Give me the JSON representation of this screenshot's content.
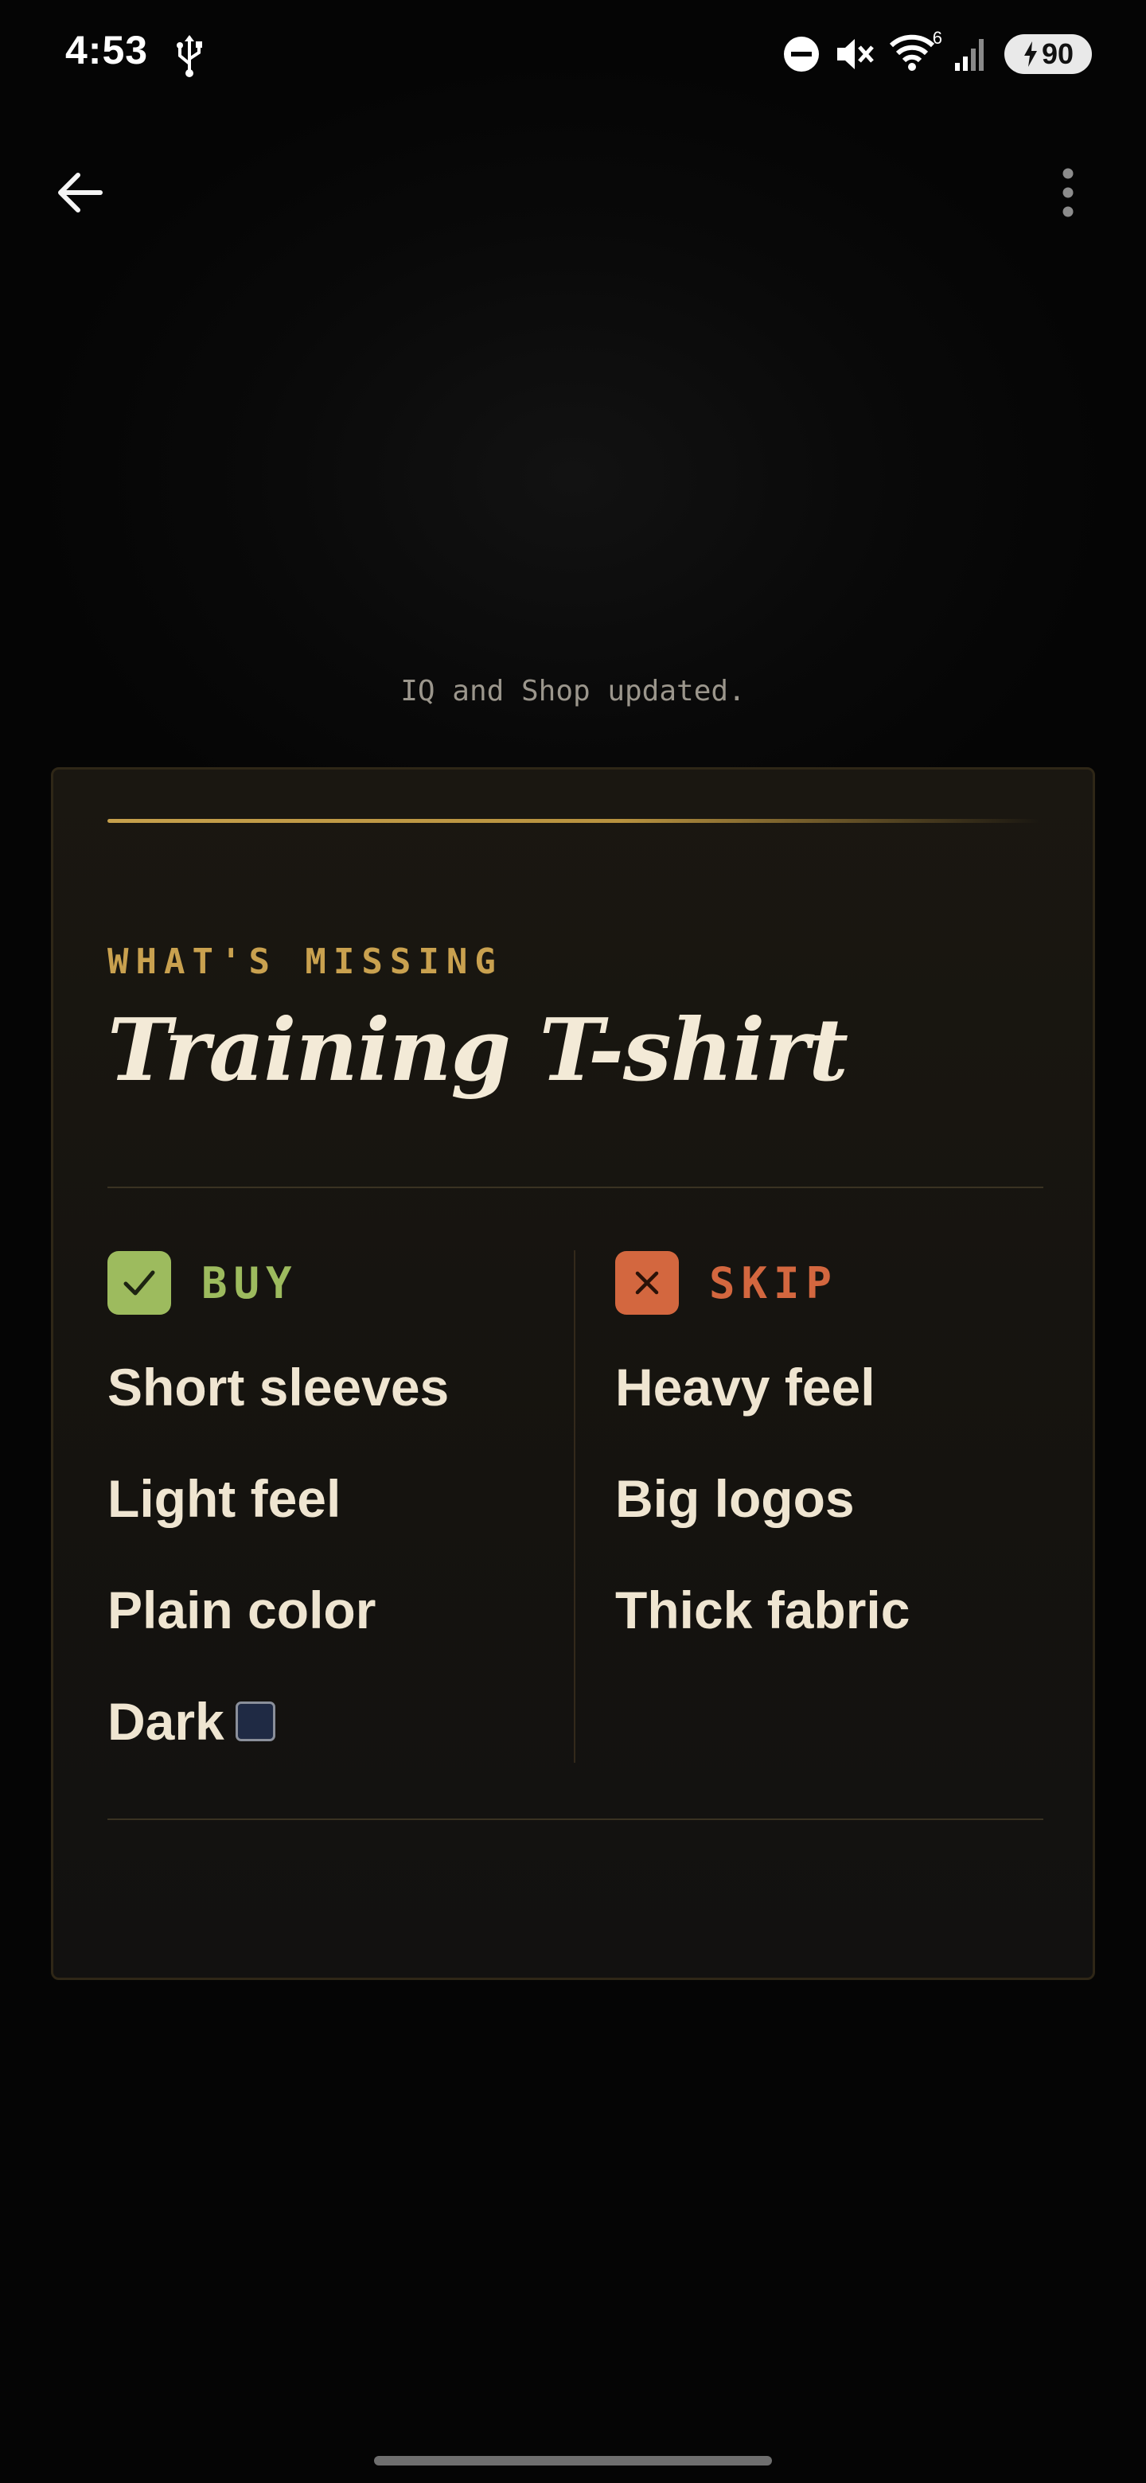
{
  "status_bar": {
    "time": "4:53",
    "battery": "90",
    "icons": [
      "usb-icon",
      "do-not-disturb-icon",
      "mute-icon",
      "wifi-icon",
      "signal-icon",
      "battery-charging-icon"
    ],
    "wifi_badge": "6"
  },
  "app_bar": {
    "back_icon": "arrow-left-icon",
    "menu_icon": "more-vert-icon"
  },
  "toast": "IQ and Shop updated.",
  "card": {
    "eyebrow": "WHAT'S MISSING",
    "title": "Training T-shirt",
    "buy": {
      "label": "BUY",
      "icon": "check-icon",
      "items": [
        "Short sleeves",
        "Light feel",
        "Plain color",
        "Dark"
      ],
      "dark_swatch_color": "#1f2a44"
    },
    "skip": {
      "label": "SKIP",
      "icon": "x-icon",
      "items": [
        "Heavy feel",
        "Big logos",
        "Thick fabric"
      ]
    }
  },
  "colors": {
    "accent_gold": "#c9a14f",
    "buy_green": "#9dbb5e",
    "skip_orange": "#d3673f",
    "background": "#050505",
    "card_bg": "#17140f",
    "text": "#efe5d1"
  }
}
